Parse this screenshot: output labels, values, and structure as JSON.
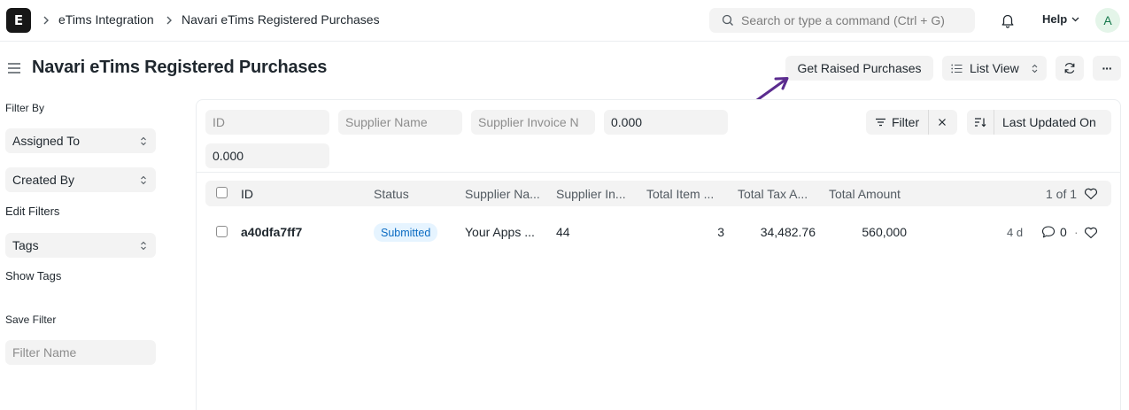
{
  "navbar": {
    "logo_letter": "E",
    "breadcrumbs": [
      "eTims Integration",
      "Navari eTims Registered Purchases"
    ],
    "search_placeholder": "Search or type a command (Ctrl + G)",
    "help_label": "Help",
    "avatar_initial": "A"
  },
  "page": {
    "title": "Navari eTims Registered Purchases",
    "actions": {
      "raised_label": "Get Raised Purchases",
      "view_label": "List View",
      "more_label": "···"
    }
  },
  "sidebar": {
    "filter_by_label": "Filter By",
    "assigned_to": "Assigned To",
    "created_by": "Created By",
    "edit_filters": "Edit Filters",
    "tags": "Tags",
    "show_tags": "Show Tags",
    "save_filter_label": "Save Filter",
    "filter_name_placeholder": "Filter Name"
  },
  "filters": {
    "id_placeholder": "ID",
    "supplier_name_placeholder": "Supplier Name",
    "supplier_invoice_placeholder": "Supplier Invoice N",
    "amount_value_1": "0.000",
    "amount_value_2": "0.000",
    "filter_label": "Filter",
    "sort_label": "Last Updated On"
  },
  "table": {
    "headers": {
      "id": "ID",
      "status": "Status",
      "supplier_name": "Supplier Na...",
      "supplier_invoice": "Supplier In...",
      "total_item": "Total Item ...",
      "total_tax": "Total Tax A...",
      "total_amount": "Total Amount",
      "count": "1 of 1"
    },
    "rows": [
      {
        "id": "a40dfa7ff7",
        "status": "Submitted",
        "supplier_name": "Your Apps ...",
        "supplier_invoice": "44",
        "total_item": "3",
        "total_tax": "34,482.76",
        "total_amount": "560,000",
        "modified": "4 d",
        "comments": "0",
        "separator": "·"
      }
    ]
  },
  "colors": {
    "annotation_arrow": "#5b2c8f",
    "badge_bg": "#e6f4ff",
    "badge_text": "#0b6bc2",
    "avatar_bg": "#e4f5e9",
    "avatar_text": "#16794c"
  }
}
